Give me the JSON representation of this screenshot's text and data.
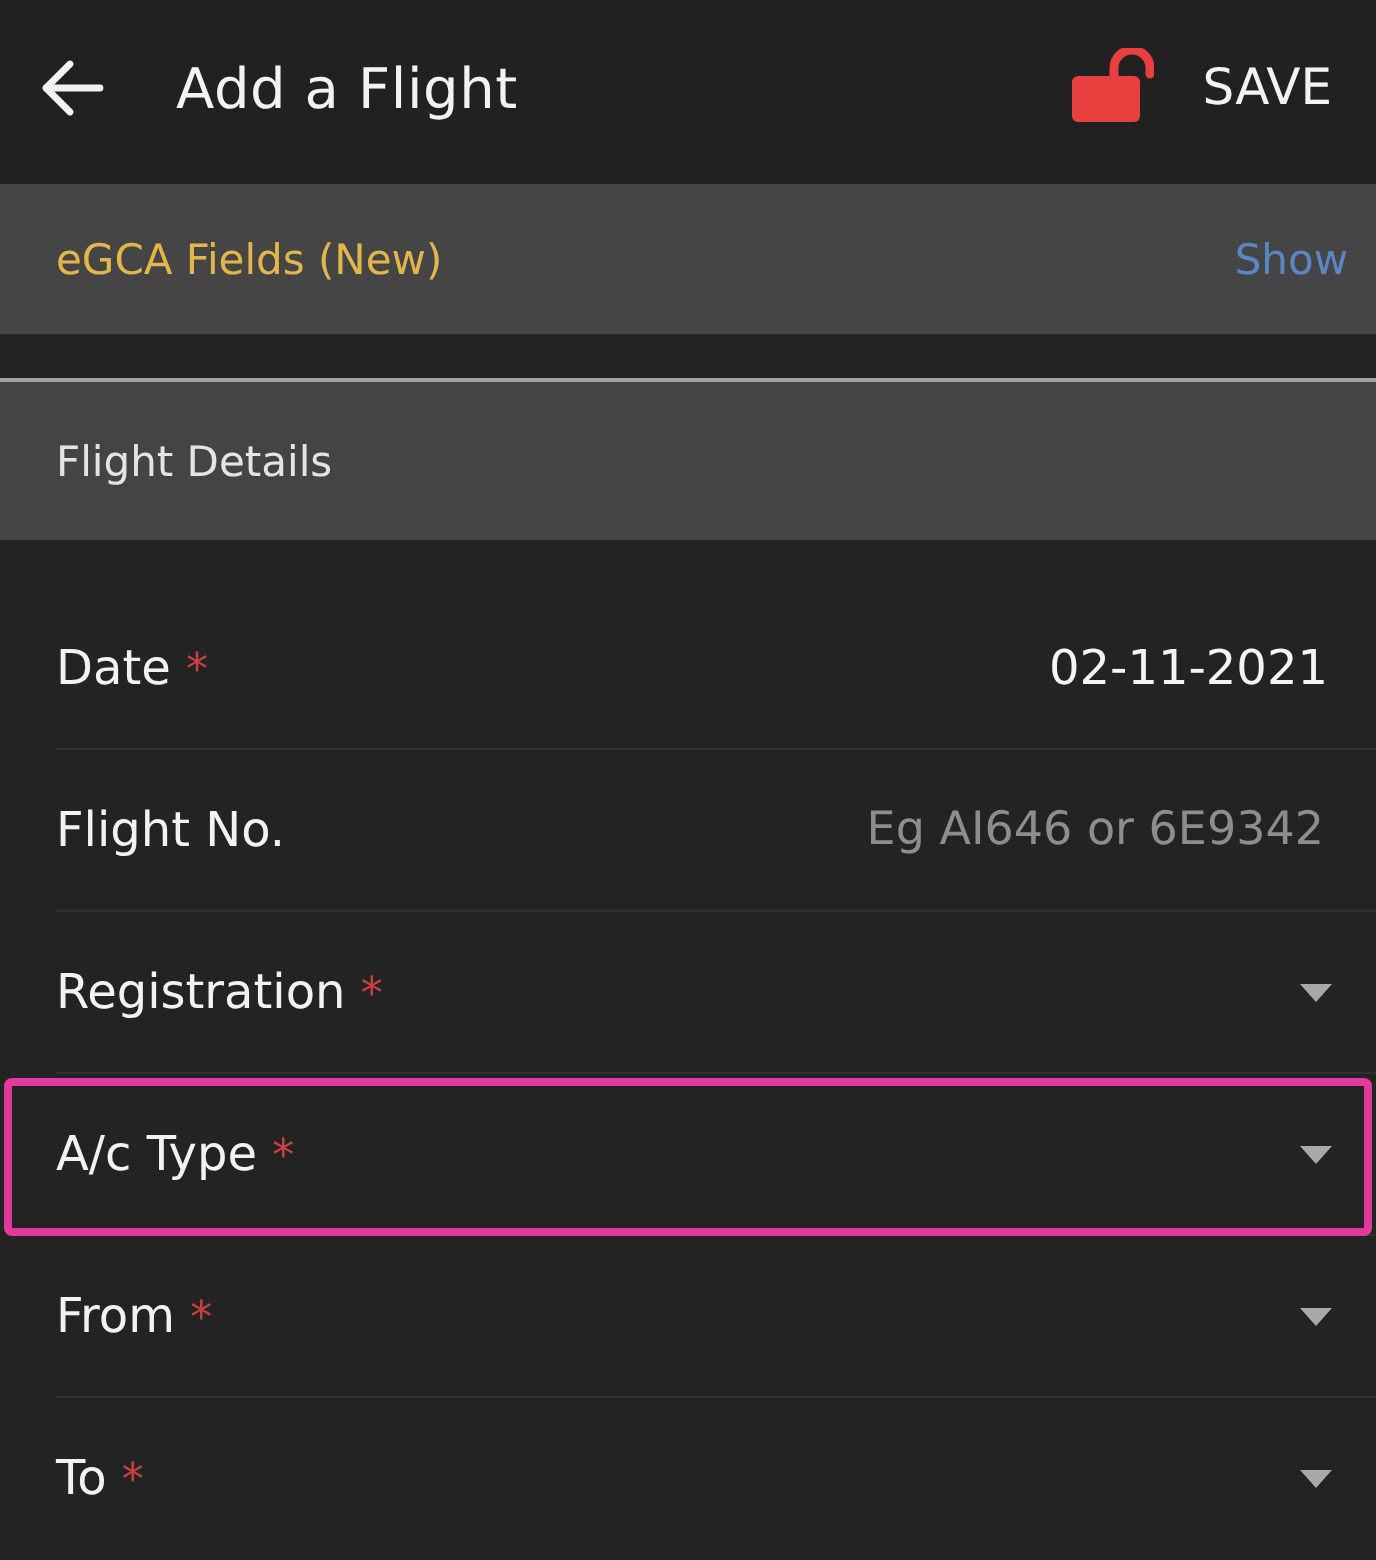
{
  "header": {
    "title": "Add a Flight",
    "lock": {
      "locked": false
    },
    "save": "SAVE"
  },
  "egca_bar": {
    "label": "eGCA Fields (New)",
    "action": "Show"
  },
  "section": {
    "title": "Flight Details"
  },
  "fields": [
    {
      "kind": "date",
      "label": "Date",
      "required_mark": "*",
      "value": "02-11-2021",
      "highlighted": false
    },
    {
      "kind": "text",
      "label": "Flight No.",
      "placeholder": "Eg AI646 or 6E9342",
      "highlighted": false
    },
    {
      "kind": "dropdown",
      "label": "Registration",
      "required_mark": "*",
      "highlighted": false
    },
    {
      "kind": "dropdown",
      "label": "A/c Type",
      "required_mark": "*",
      "highlighted": true
    },
    {
      "kind": "dropdown",
      "label": "From",
      "required_mark": "*",
      "highlighted": false
    },
    {
      "kind": "dropdown",
      "label": "To",
      "required_mark": "*",
      "highlighted": false
    }
  ]
}
